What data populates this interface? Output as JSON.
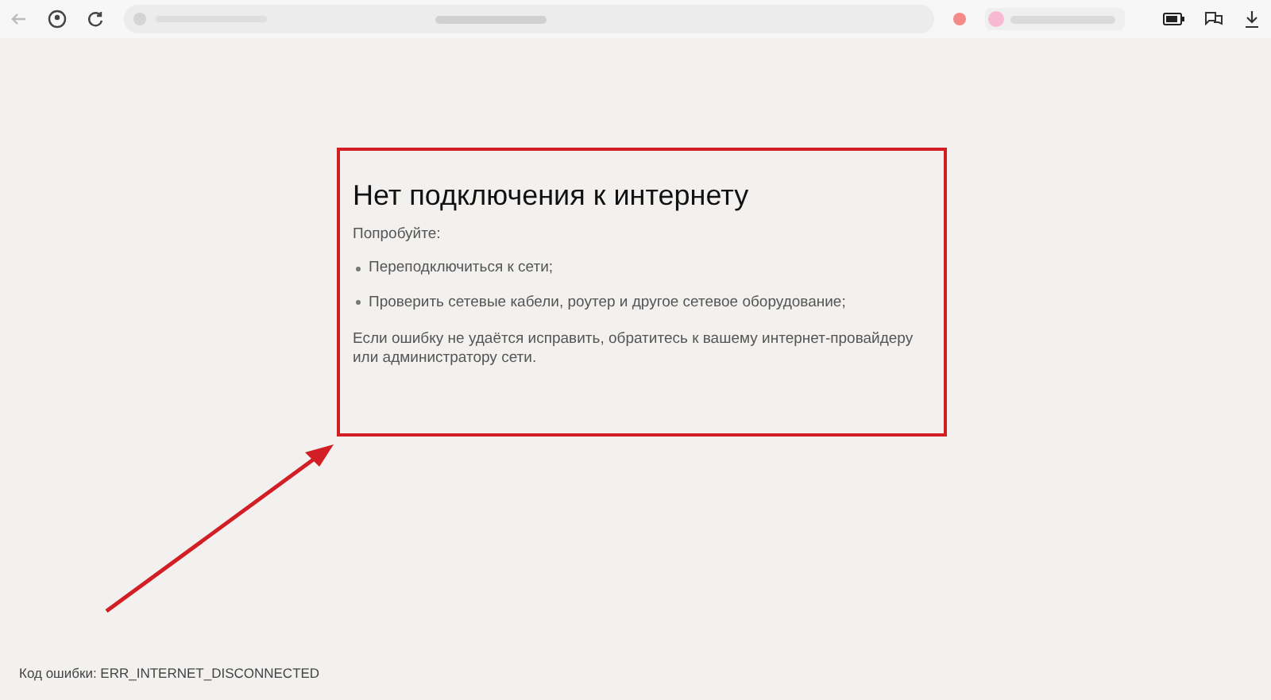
{
  "error_page": {
    "title": "Нет подключения к интернету",
    "intro": "Попробуйте:",
    "suggestions": [
      "Переподключиться к сети;",
      "Проверить сетевые кабели, роутер и другое сетевое оборудование;"
    ],
    "advice": "Если ошибку не удаётся исправить, обратитесь к вашему интернет-провайдеру или администратору сети.",
    "error_code": "Код ошибки: ERR_INTERNET_DISCONNECTED"
  }
}
